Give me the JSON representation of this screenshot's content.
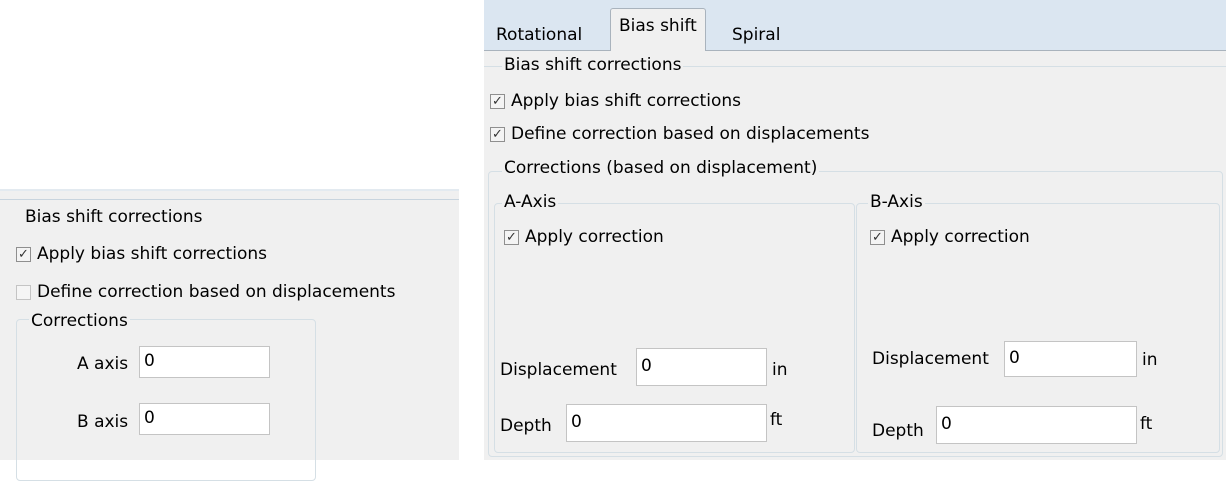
{
  "left_panel": {
    "group_title": "Bias shift corrections",
    "apply_label": "Apply bias shift corrections",
    "apply_checked": true,
    "define_label": "Define correction based on displacements",
    "define_checked": false,
    "corrections_title": "Corrections",
    "a_axis_label": "A axis",
    "a_axis_value": "0",
    "b_axis_label": "B axis",
    "b_axis_value": "0"
  },
  "right_panel": {
    "tabs": [
      {
        "label": "Rotational",
        "active": false
      },
      {
        "label": "Bias shift",
        "active": true
      },
      {
        "label": "Spiral",
        "active": false
      }
    ],
    "group_title": "Bias shift corrections",
    "apply_label": "Apply bias shift corrections",
    "apply_checked": true,
    "define_label": "Define correction based on displacements",
    "define_checked": true,
    "corrections_title": "Corrections (based on displacement)",
    "a_axis": {
      "title": "A-Axis",
      "apply_label": "Apply correction",
      "apply_checked": true,
      "displacement_label": "Displacement",
      "displacement_value": "0",
      "displacement_unit": "in",
      "depth_label": "Depth",
      "depth_value": "0",
      "depth_unit": "ft"
    },
    "b_axis": {
      "title": "B-Axis",
      "apply_label": "Apply correction",
      "apply_checked": true,
      "displacement_label": "Displacement",
      "displacement_value": "0",
      "displacement_unit": "in",
      "depth_label": "Depth",
      "depth_value": "0",
      "depth_unit": "ft"
    }
  },
  "colors": {
    "panel_bg": "#f0f0f0",
    "tab_strip_bg": "#dbe6f1",
    "border": "#d5dfe5"
  }
}
